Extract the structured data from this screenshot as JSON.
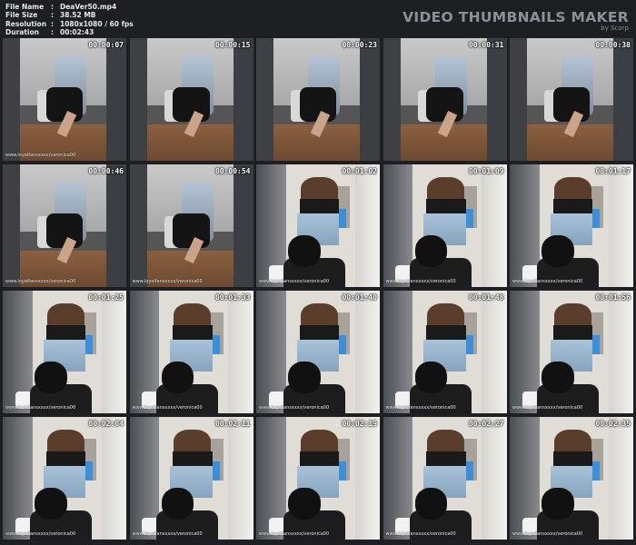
{
  "meta": {
    "rows": [
      {
        "key": "File Name",
        "sep": ":",
        "value": "DeaVer50.mp4"
      },
      {
        "key": "File Size",
        "sep": ":",
        "value": "38.52 MB"
      },
      {
        "key": "Resolution",
        "sep": ":",
        "value": "1080x1080 / 60 fps"
      },
      {
        "key": "Duration",
        "sep": ":",
        "value": "00:02:43"
      }
    ]
  },
  "brand": {
    "title": "VIDEO THUMBNAILS MAKER",
    "subtitle": "by Scorp"
  },
  "thumbnails": [
    {
      "time": "00:00:07",
      "scene": "A",
      "watermark": "www.loyalfansxxxx/veronica00"
    },
    {
      "time": "00:00:15",
      "scene": "A",
      "watermark": ""
    },
    {
      "time": "00:00:23",
      "scene": "A",
      "watermark": ""
    },
    {
      "time": "00:00:31",
      "scene": "A",
      "watermark": ""
    },
    {
      "time": "00:00:38",
      "scene": "A",
      "watermark": ""
    },
    {
      "time": "00:00:46",
      "scene": "A",
      "watermark": "www.loyalfansxxxx/veronica00"
    },
    {
      "time": "00:00:54",
      "scene": "A",
      "watermark": "www.loyalfansxxxx/veronica00"
    },
    {
      "time": "00:01:02",
      "scene": "B",
      "watermark": "www.loyalfansxxxx/veronica00"
    },
    {
      "time": "00:01:09",
      "scene": "B",
      "watermark": "www.loyalfansxxxx/veronica00"
    },
    {
      "time": "00:01:17",
      "scene": "B",
      "watermark": "www.loyalfansxxxx/veronica00"
    },
    {
      "time": "00:01:25",
      "scene": "B",
      "watermark": "www.loyalfansxxxx/veronica00"
    },
    {
      "time": "00:01:33",
      "scene": "B",
      "watermark": "www.loyalfansxxxx/veronica00"
    },
    {
      "time": "00:01:40",
      "scene": "B",
      "watermark": "www.loyalfansxxxx/veronica00"
    },
    {
      "time": "00:01:48",
      "scene": "B",
      "watermark": "www.loyalfansxxxx/veronica00"
    },
    {
      "time": "00:01:56",
      "scene": "B",
      "watermark": "www.loyalfansxxxx/veronica00"
    },
    {
      "time": "00:02:04",
      "scene": "B",
      "watermark": "www.loyalfansxxxx/veronica00"
    },
    {
      "time": "00:02:11",
      "scene": "B",
      "watermark": "www.loyalfansxxxx/veronica00"
    },
    {
      "time": "00:02:19",
      "scene": "B",
      "watermark": "www.loyalfansxxxx/veronica00"
    },
    {
      "time": "00:02:27",
      "scene": "B",
      "watermark": "www.loyalfansxxxx/veronica00"
    },
    {
      "time": "00:02:35",
      "scene": "B",
      "watermark": "www.loyalfansxxxx/veronica00"
    }
  ]
}
